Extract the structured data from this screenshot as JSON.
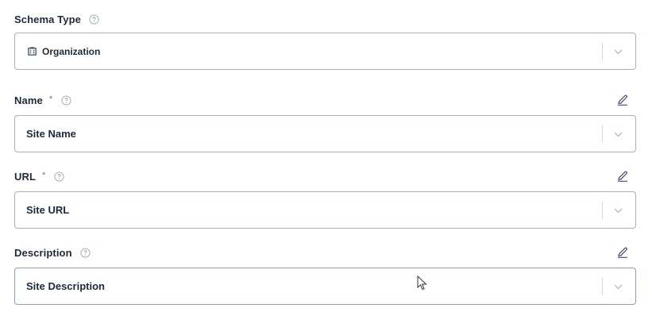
{
  "fields": [
    {
      "label": "Schema Type",
      "required": false,
      "editable": false,
      "value": "Organization",
      "value_icon": "building-icon"
    },
    {
      "label": "Name",
      "required": true,
      "required_marker": "*",
      "editable": true,
      "value": "Site Name"
    },
    {
      "label": "URL",
      "required": true,
      "required_marker": "*",
      "editable": true,
      "value": "Site URL"
    },
    {
      "label": "Description",
      "required": false,
      "editable": true,
      "value": "Site Description"
    }
  ],
  "icons": {
    "help": "question-circle-icon",
    "edit": "pencil-icon",
    "dropdown": "chevron-down-icon"
  },
  "colors": {
    "border": "#a8b0bb",
    "text": "#1e293b",
    "muted": "#94a3b8"
  }
}
